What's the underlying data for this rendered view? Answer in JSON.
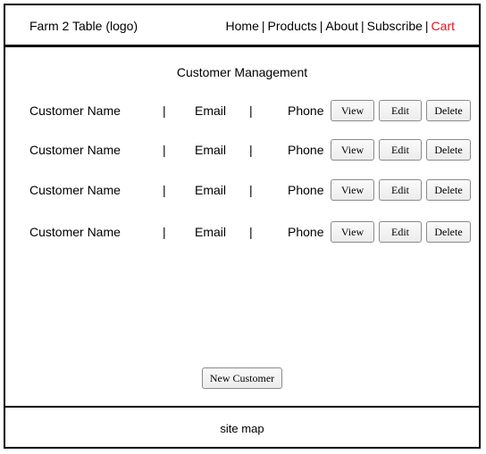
{
  "header": {
    "logo": "Farm 2 Table (logo)",
    "nav": [
      {
        "label": "Home",
        "color": "#000000"
      },
      {
        "label": "Products",
        "color": "#000000"
      },
      {
        "label": "About",
        "color": "#000000"
      },
      {
        "label": "Subscribe",
        "color": "#000000"
      },
      {
        "label": "Cart",
        "color": "#e8141c"
      }
    ],
    "separator": "|"
  },
  "main": {
    "title": "Customer Management",
    "rows": [
      {
        "name": "Customer Name",
        "email": "Email",
        "phone": "Phone",
        "sep": "|",
        "view": "View",
        "edit": "Edit",
        "delete": "Delete"
      },
      {
        "name": "Customer Name",
        "email": "Email",
        "phone": "Phone",
        "sep": "|",
        "view": "View",
        "edit": "Edit",
        "delete": "Delete"
      },
      {
        "name": "Customer Name",
        "email": "Email",
        "phone": "Phone",
        "sep": "|",
        "view": "View",
        "edit": "Edit",
        "delete": "Delete"
      },
      {
        "name": "Customer Name",
        "email": "Email",
        "phone": "Phone",
        "sep": "|",
        "view": "View",
        "edit": "Edit",
        "delete": "Delete"
      }
    ],
    "new_customer_label": "New Customer"
  },
  "footer": {
    "sitemap": "site map"
  }
}
